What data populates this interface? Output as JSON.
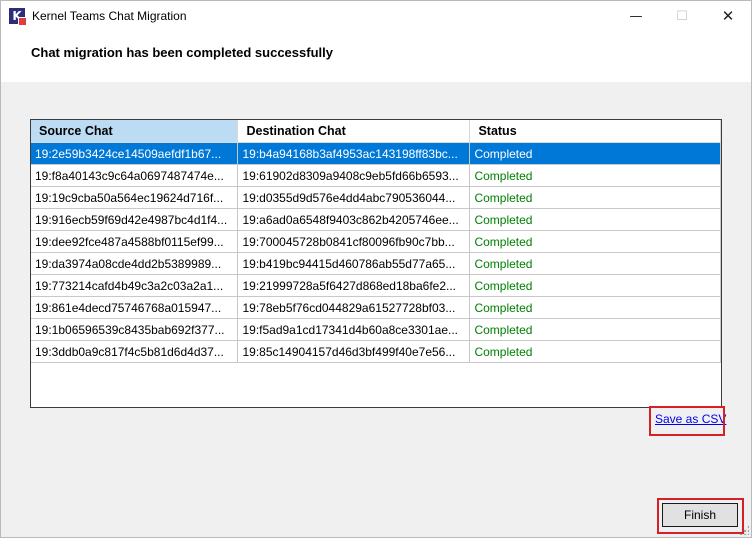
{
  "window": {
    "title": "Kernel Teams Chat Migration",
    "icon_letter": "K",
    "controls": {
      "minimize": "—",
      "maximize": "☐",
      "close": "✕"
    }
  },
  "heading": "Chat migration has been completed successfully",
  "table": {
    "columns": [
      "Source Chat",
      "Destination Chat",
      "Status"
    ],
    "selected_row": 0,
    "rows": [
      {
        "source": "19:2e59b3424ce14509aefdf1b67...",
        "destination": "19:b4a94168b3af4953ac143198ff83bc...",
        "status": "Completed"
      },
      {
        "source": "19:f8a40143c9c64a0697487474e...",
        "destination": "19:61902d8309a9408c9eb5fd66b6593...",
        "status": "Completed"
      },
      {
        "source": "19:19c9cba50a564ec19624d716f...",
        "destination": "19:d0355d9d576e4dd4abc790536044...",
        "status": "Completed"
      },
      {
        "source": "19:916ecb59f69d42e4987bc4d1f4...",
        "destination": "19:a6ad0a6548f9403c862b4205746ee...",
        "status": "Completed"
      },
      {
        "source": "19:dee92fce487a4588bf0115ef99...",
        "destination": "19:700045728b0841cf80096fb90c7bb...",
        "status": "Completed"
      },
      {
        "source": "19:da3974a08cde4dd2b5389989...",
        "destination": "19:b419bc94415d460786ab55d77a65...",
        "status": "Completed"
      },
      {
        "source": "19:773214cafd4b49c3a2c03a2a1...",
        "destination": "19:21999728a5f6427d868ed18ba6fe2...",
        "status": "Completed"
      },
      {
        "source": "19:861e4decd75746768a015947...",
        "destination": "19:78eb5f76cd044829a61527728bf03...",
        "status": "Completed"
      },
      {
        "source": "19:1b06596539c8435bab692f377...",
        "destination": "19:f5ad9a1cd17341d4b60a8ce3301ae...",
        "status": "Completed"
      },
      {
        "source": "19:3ddb0a9c817f4c5b81d6d4d37...",
        "destination": "19:85c14904157d46d3bf499f40e7e56...",
        "status": "Completed"
      }
    ]
  },
  "links": {
    "save_csv": "Save as CSV"
  },
  "buttons": {
    "finish": "Finish"
  },
  "colors": {
    "selection": "#0078d7",
    "status_completed": "#008000",
    "highlight_box": "#d61f26",
    "header_active": "#bcdcf4"
  }
}
